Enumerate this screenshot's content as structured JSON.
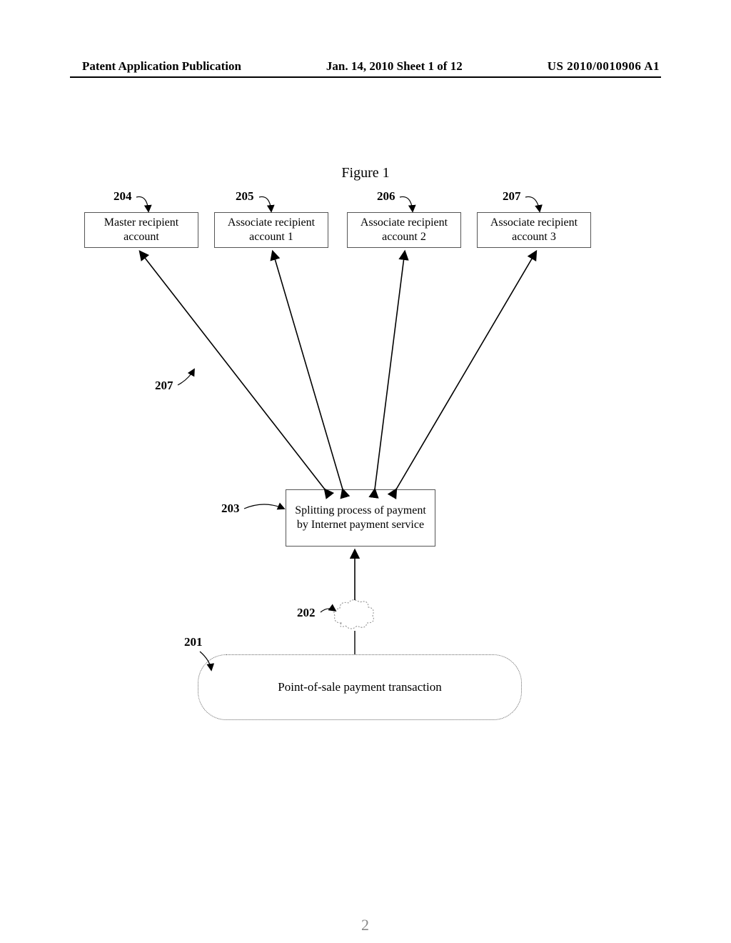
{
  "header": {
    "left": "Patent Application Publication",
    "center": "Jan. 14, 2010  Sheet 1 of 12",
    "right": "US 2010/0010906 A1"
  },
  "figure": {
    "title": "Figure 1",
    "boxes": {
      "b204": "Master recipient account",
      "b205": "Associate recipient account 1",
      "b206": "Associate recipient account 2",
      "b207": "Associate recipient account 3",
      "b203": "Splitting process of payment by Internet payment service",
      "b201": "Point-of-sale payment transaction"
    },
    "refs": {
      "r204": "204",
      "r205": "205",
      "r206": "206",
      "r207": "207",
      "r207b": "207",
      "r203": "203",
      "r202": "202",
      "r201": "201"
    }
  },
  "page": "2"
}
